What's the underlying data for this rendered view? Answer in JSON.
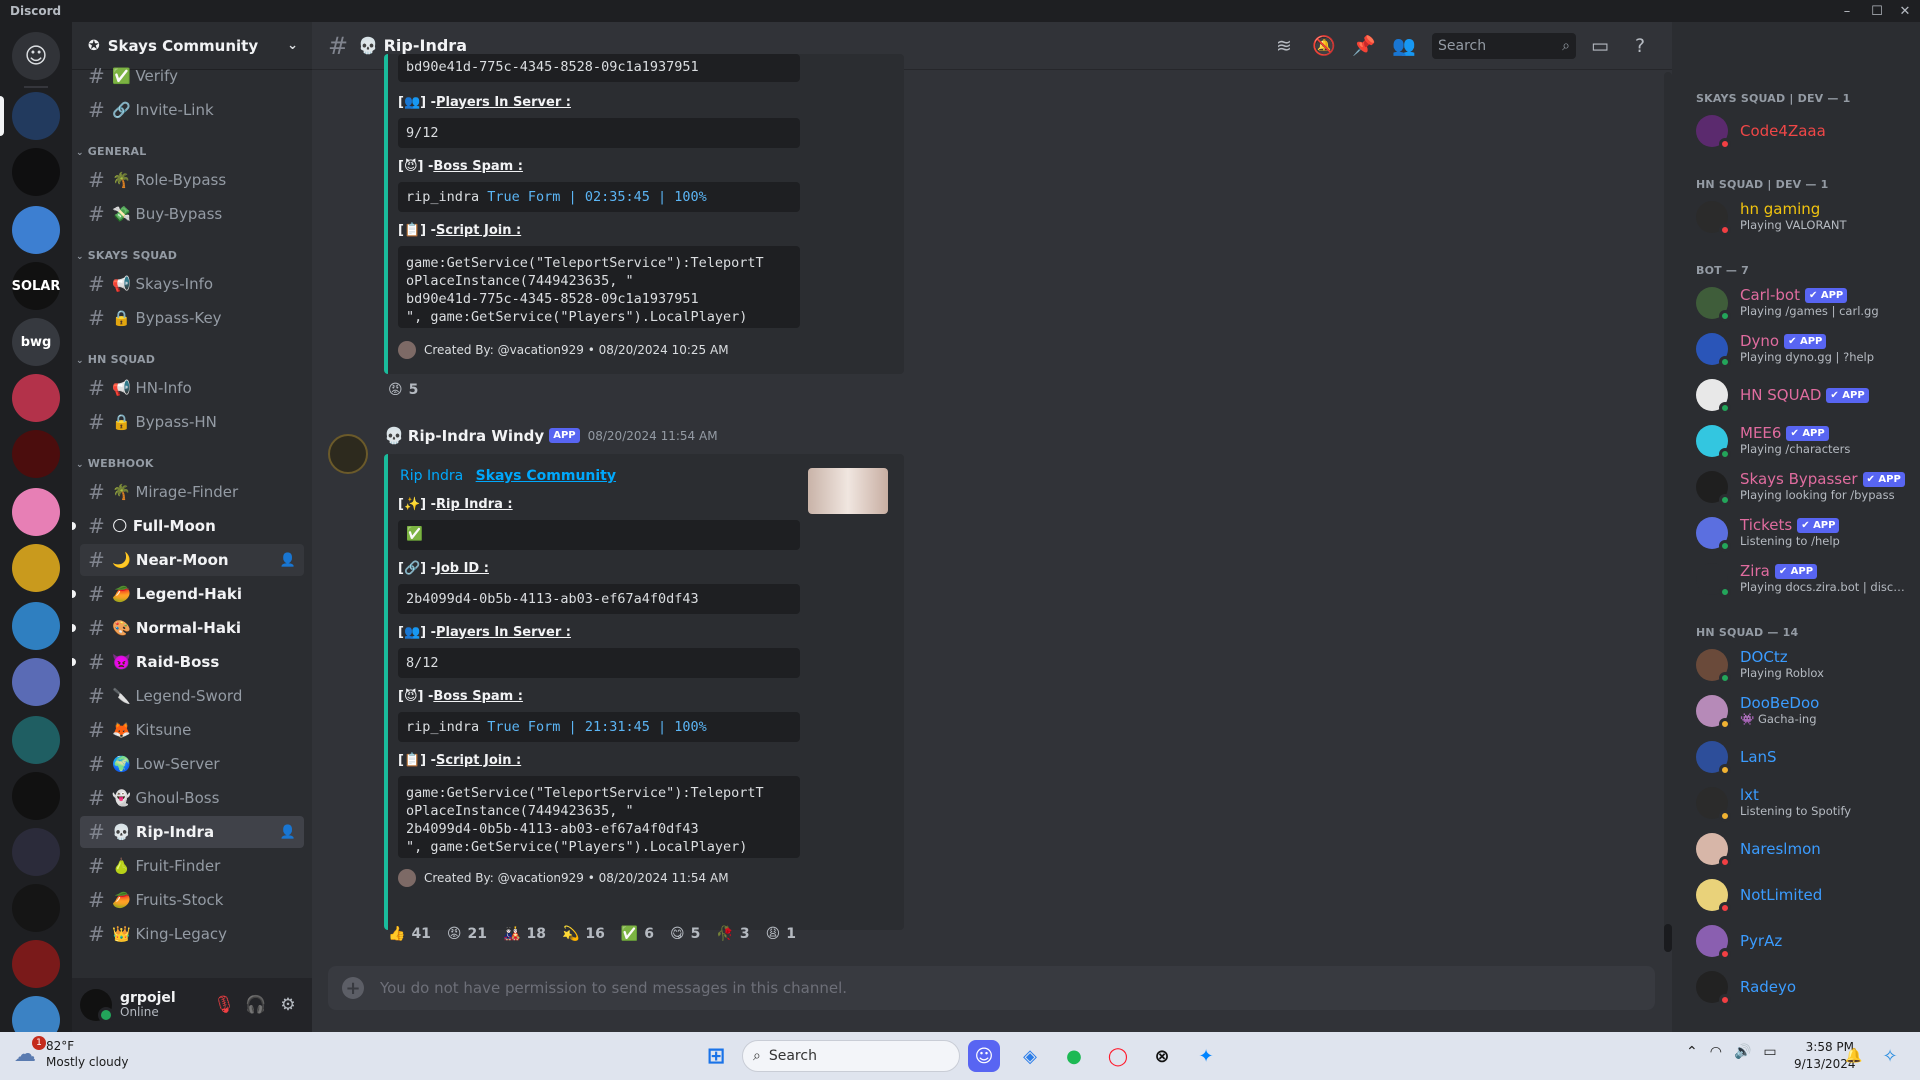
{
  "window": {
    "app_name": "Discord",
    "minimize": "–",
    "maximize": "☐",
    "close": "✕"
  },
  "servers": [
    {
      "name": "direct-messages",
      "label": "",
      "color": "#313338"
    },
    {
      "name": "server-1",
      "label": "",
      "color": "#223a5e"
    },
    {
      "name": "server-2",
      "label": "",
      "color": "#0f0f10"
    },
    {
      "name": "server-3",
      "label": "",
      "color": "#3d7fd1"
    },
    {
      "name": "server-solar",
      "label": "SOLAR",
      "color": "#111111"
    },
    {
      "name": "server-bwg",
      "label": "bwg",
      "color": "#36393f"
    },
    {
      "name": "server-6",
      "label": "",
      "color": "#b3324a"
    },
    {
      "name": "server-eternal",
      "label": "",
      "color": "#4b0d0d"
    },
    {
      "name": "server-8",
      "label": "",
      "color": "#e77fb5"
    },
    {
      "name": "server-9",
      "label": "",
      "color": "#c99a1d"
    },
    {
      "name": "server-10",
      "label": "",
      "color": "#2f7fc0"
    },
    {
      "name": "server-11",
      "label": "",
      "color": "#5a6bb5"
    },
    {
      "name": "server-12",
      "label": "",
      "color": "#1f5e62"
    },
    {
      "name": "server-13",
      "label": "",
      "color": "#111111"
    },
    {
      "name": "server-14",
      "label": "",
      "color": "#2b2b3a"
    },
    {
      "name": "server-15",
      "label": "",
      "color": "#151515"
    },
    {
      "name": "server-16",
      "label": "",
      "color": "#7a1a1a"
    },
    {
      "name": "server-17",
      "label": "",
      "color": "#3b82c4"
    }
  ],
  "guild": {
    "name": "Skays Community"
  },
  "channels": {
    "top": [
      {
        "label": "✅ Verify"
      },
      {
        "label": "🔗 Invite-Link"
      }
    ],
    "general": {
      "label": "GENERAL",
      "items": [
        {
          "label": "🌴 Role-Bypass"
        },
        {
          "label": "💸 Buy-Bypass"
        }
      ]
    },
    "skays_squad": {
      "label": "SKAYS SQUAD",
      "items": [
        {
          "label": "📢 Skays-Info"
        },
        {
          "label": "🔒 Bypass-Key"
        }
      ]
    },
    "hn_squad": {
      "label": "HN SQUAD",
      "items": [
        {
          "label": "📢 HN-Info"
        },
        {
          "label": "🔒 Bypass-HN"
        }
      ]
    },
    "webhook": {
      "label": "WEBHOOK",
      "items": [
        {
          "label": "🌴 Mirage-Finder"
        },
        {
          "label": "🌕 Full-Moon"
        },
        {
          "label": "🌙 Near-Moon"
        },
        {
          "label": "🥭 Legend-Haki"
        },
        {
          "label": "🎨 Normal-Haki"
        },
        {
          "label": "👿 Raid-Boss"
        },
        {
          "label": "🔪 Legend-Sword"
        },
        {
          "label": "🦊 Kitsune"
        },
        {
          "label": "🌍 Low-Server"
        },
        {
          "label": "👻 Ghoul-Boss"
        },
        {
          "label": "💀 Rip-Indra"
        },
        {
          "label": "🍐 Fruit-Finder"
        },
        {
          "label": "🥭 Fruits-Stock"
        },
        {
          "label": "👑 King-Legacy"
        }
      ]
    }
  },
  "user": {
    "name": "grpojel",
    "status": "Online"
  },
  "chat": {
    "channel_title": "💀 Rip-Indra",
    "search_placeholder": "Search",
    "top_partial_code": "bd90e41d-775c-4345-8528-09c1a1937951",
    "embed1": {
      "players_label": "Players In Server :",
      "players_value": "9/12",
      "boss_label": "Boss Spam :",
      "boss_name": "rip_indra ",
      "boss_rest": "True Form | 02:35:45 | 100%",
      "script_label": "Script Join :",
      "script_code": "game:GetService(\"TeleportService\"):TeleportT\noPlaceInstance(7449423635, \"\nbd90e41d-775c-4345-8528-09c1a1937951\n\", game:GetService(\"Players\").LocalPlayer)",
      "footer": "Created By: @vacation929 • 08/20/2024 10:25 AM"
    },
    "reactions1": [
      {
        "emoji": "😡",
        "count": "5"
      }
    ],
    "message2": {
      "author": "Rip-Indra Windy",
      "tag": "APP",
      "timestamp": "08/20/2024 11:54 AM",
      "embed_author": "Rip Indra",
      "embed_title": "Skays Community",
      "ripindra_label": "Rip Indra :",
      "ripindra_value": "✅",
      "jobid_label": "Job ID :",
      "jobid_value": "2b4099d4-0b5b-4113-ab03-ef67a4f0df43",
      "players_label": "Players In Server :",
      "players_value": "8/12",
      "boss_label": "Boss Spam :",
      "boss_name": "rip_indra ",
      "boss_rest": "True Form | 21:31:45 | 100%",
      "script_label": "Script Join :",
      "script_code": "game:GetService(\"TeleportService\"):TeleportT\noPlaceInstance(7449423635, \"\n2b4099d4-0b5b-4113-ab03-ef67a4f0df43\n\", game:GetService(\"Players\").LocalPlayer)",
      "footer": "Created By: @vacation929 • 08/20/2024 11:54 AM"
    },
    "reactions2": [
      {
        "emoji": "👍",
        "count": "41"
      },
      {
        "emoji": "😡",
        "count": "21"
      },
      {
        "emoji": "🎎",
        "count": "18"
      },
      {
        "emoji": "💫",
        "count": "16"
      },
      {
        "emoji": "✅",
        "count": "6"
      },
      {
        "emoji": "😋",
        "count": "5"
      },
      {
        "emoji": "🥀",
        "count": "3"
      },
      {
        "emoji": "😩",
        "count": "1"
      }
    ],
    "input_placeholder": "You do not have permission to send messages in this channel."
  },
  "members": {
    "groups": [
      {
        "label": "SKAYS SQUAD | DEV — 1",
        "members": [
          {
            "name": "Code4Zaaa",
            "color": "#f04747",
            "status": "dnd",
            "activity": "",
            "app": false
          }
        ]
      },
      {
        "label": "HN SQUAD | DEV — 1",
        "members": [
          {
            "name": "hn gaming",
            "color": "#f1c40f",
            "status": "dnd",
            "activity": "Playing VALORANT",
            "app": false
          }
        ]
      },
      {
        "label": "BOT — 7",
        "members": [
          {
            "name": "Carl-bot",
            "color": "#e06c9f",
            "status": "online",
            "activity": "Playing /games | carl.gg",
            "app": true
          },
          {
            "name": "Dyno",
            "color": "#e06c9f",
            "status": "online",
            "activity": "Playing dyno.gg | ?help",
            "app": true
          },
          {
            "name": "HN SQUAD",
            "color": "#e06c9f",
            "status": "online",
            "activity": "",
            "app": true
          },
          {
            "name": "MEE6",
            "color": "#e06c9f",
            "status": "online",
            "activity": "Playing /characters",
            "app": true
          },
          {
            "name": "Skays Bypasser",
            "color": "#e06c9f",
            "status": "online",
            "activity": "Playing looking for /bypass",
            "app": true
          },
          {
            "name": "Tickets",
            "color": "#e06c9f",
            "status": "online",
            "activity": "Listening to /help",
            "app": true
          },
          {
            "name": "Zira",
            "color": "#e06c9f",
            "status": "online",
            "activity": "Playing docs.zira.bot | discord...",
            "app": true
          }
        ]
      },
      {
        "label": "HN SQUAD — 14",
        "members": [
          {
            "name": "DOCtz",
            "color": "#3b9cff",
            "status": "online",
            "activity": "Playing Roblox",
            "app": false
          },
          {
            "name": "DooBeDoo",
            "color": "#3b9cff",
            "status": "idle",
            "activity": "👾 Gacha-ing",
            "app": false
          },
          {
            "name": "LanS",
            "color": "#3b9cff",
            "status": "idle",
            "activity": "",
            "app": false
          },
          {
            "name": "lxt",
            "color": "#3b9cff",
            "status": "idle",
            "activity": "Listening to Spotify",
            "app": false
          },
          {
            "name": "Nareslmon",
            "color": "#3b9cff",
            "status": "dnd",
            "activity": "",
            "app": false
          },
          {
            "name": "NotLimited",
            "color": "#3b9cff",
            "status": "dnd",
            "activity": "",
            "app": false
          },
          {
            "name": "PyrAz",
            "color": "#3b9cff",
            "status": "dnd",
            "activity": "",
            "app": false
          },
          {
            "name": "Radeyo",
            "color": "#3b9cff",
            "status": "dnd",
            "activity": "",
            "app": false
          }
        ]
      }
    ]
  },
  "taskbar": {
    "weather_temp": "82°F",
    "weather_desc": "Mostly cloudy",
    "weather_badge": "1",
    "search_label": "Search",
    "time": "3:58 PM",
    "date": "9/13/2024"
  },
  "colors": {
    "accent": "#5865f2",
    "embed_bar": "#1abc9c",
    "online": "#23a55a",
    "idle": "#f0b232",
    "dnd": "#f23f43"
  }
}
